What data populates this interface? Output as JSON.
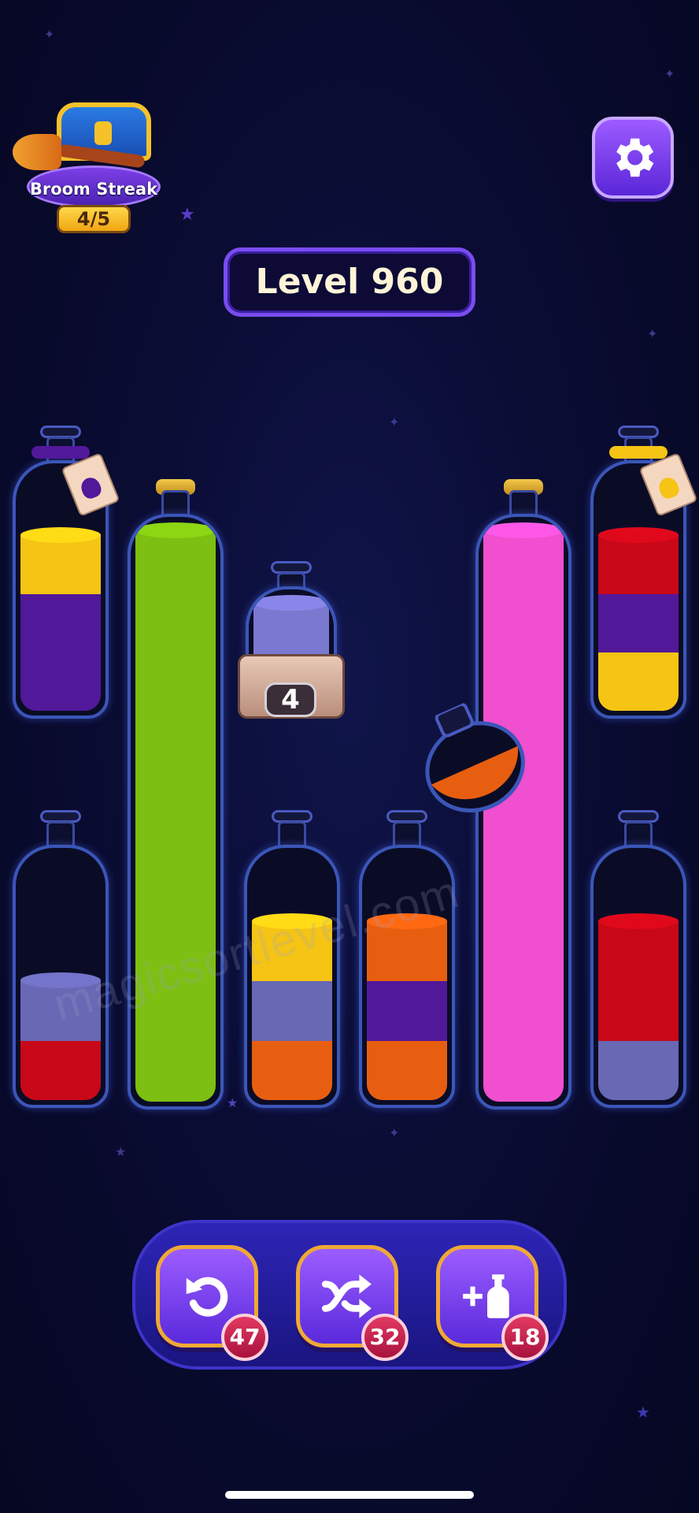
{
  "streak": {
    "label": "Broom Streak",
    "count": "4/5",
    "chest_icon": "treasure-chest",
    "broom_icon": "broom"
  },
  "settings": {
    "icon": "gear"
  },
  "level": {
    "label": "Level 960"
  },
  "colors": {
    "yellow": "#f5c414",
    "purple": "#52189a",
    "green": "#7dbf12",
    "pink": "#f04fcf",
    "red": "#c80818",
    "lavender": "#6868b4",
    "orange": "#e85e10",
    "lightpurple": "#7b78d0"
  },
  "bottles": [
    {
      "id": "top-left",
      "capacity": 4,
      "layers": [
        "purple",
        "purple",
        "yellow"
      ],
      "tag_color": "purple"
    },
    {
      "id": "tall-green",
      "capacity": 8,
      "layers": [
        "green",
        "green",
        "green",
        "green",
        "green",
        "green",
        "green",
        "green"
      ],
      "corked": true
    },
    {
      "id": "locked",
      "capacity": 1,
      "layers": [
        "lightpurple"
      ],
      "locked_count": "4"
    },
    {
      "id": "tall-pink",
      "capacity": 8,
      "layers": [
        "pink",
        "pink",
        "pink",
        "pink",
        "pink",
        "pink",
        "pink",
        "pink"
      ],
      "corked": true
    },
    {
      "id": "top-right",
      "capacity": 4,
      "layers": [
        "yellow",
        "purple",
        "red"
      ],
      "tag_color": "yellow"
    },
    {
      "id": "bottom-1",
      "capacity": 4,
      "layers": [
        "red",
        "lavender"
      ]
    },
    {
      "id": "bottom-3",
      "capacity": 4,
      "layers": [
        "orange",
        "lavender",
        "yellow"
      ]
    },
    {
      "id": "bottom-4",
      "capacity": 4,
      "layers": [
        "orange",
        "purple",
        "orange"
      ]
    },
    {
      "id": "bottom-6",
      "capacity": 4,
      "layers": [
        "lavender",
        "red",
        "red"
      ]
    }
  ],
  "pouring_flask": {
    "color": "orange",
    "level": 0.5
  },
  "watermark": "magicsortlevel.com",
  "tools": [
    {
      "name": "undo",
      "icon": "undo-arrow",
      "count": "47"
    },
    {
      "name": "shuffle",
      "icon": "shuffle-arrows",
      "count": "32"
    },
    {
      "name": "add-bottle",
      "icon": "plus-bottle",
      "count": "18"
    }
  ]
}
